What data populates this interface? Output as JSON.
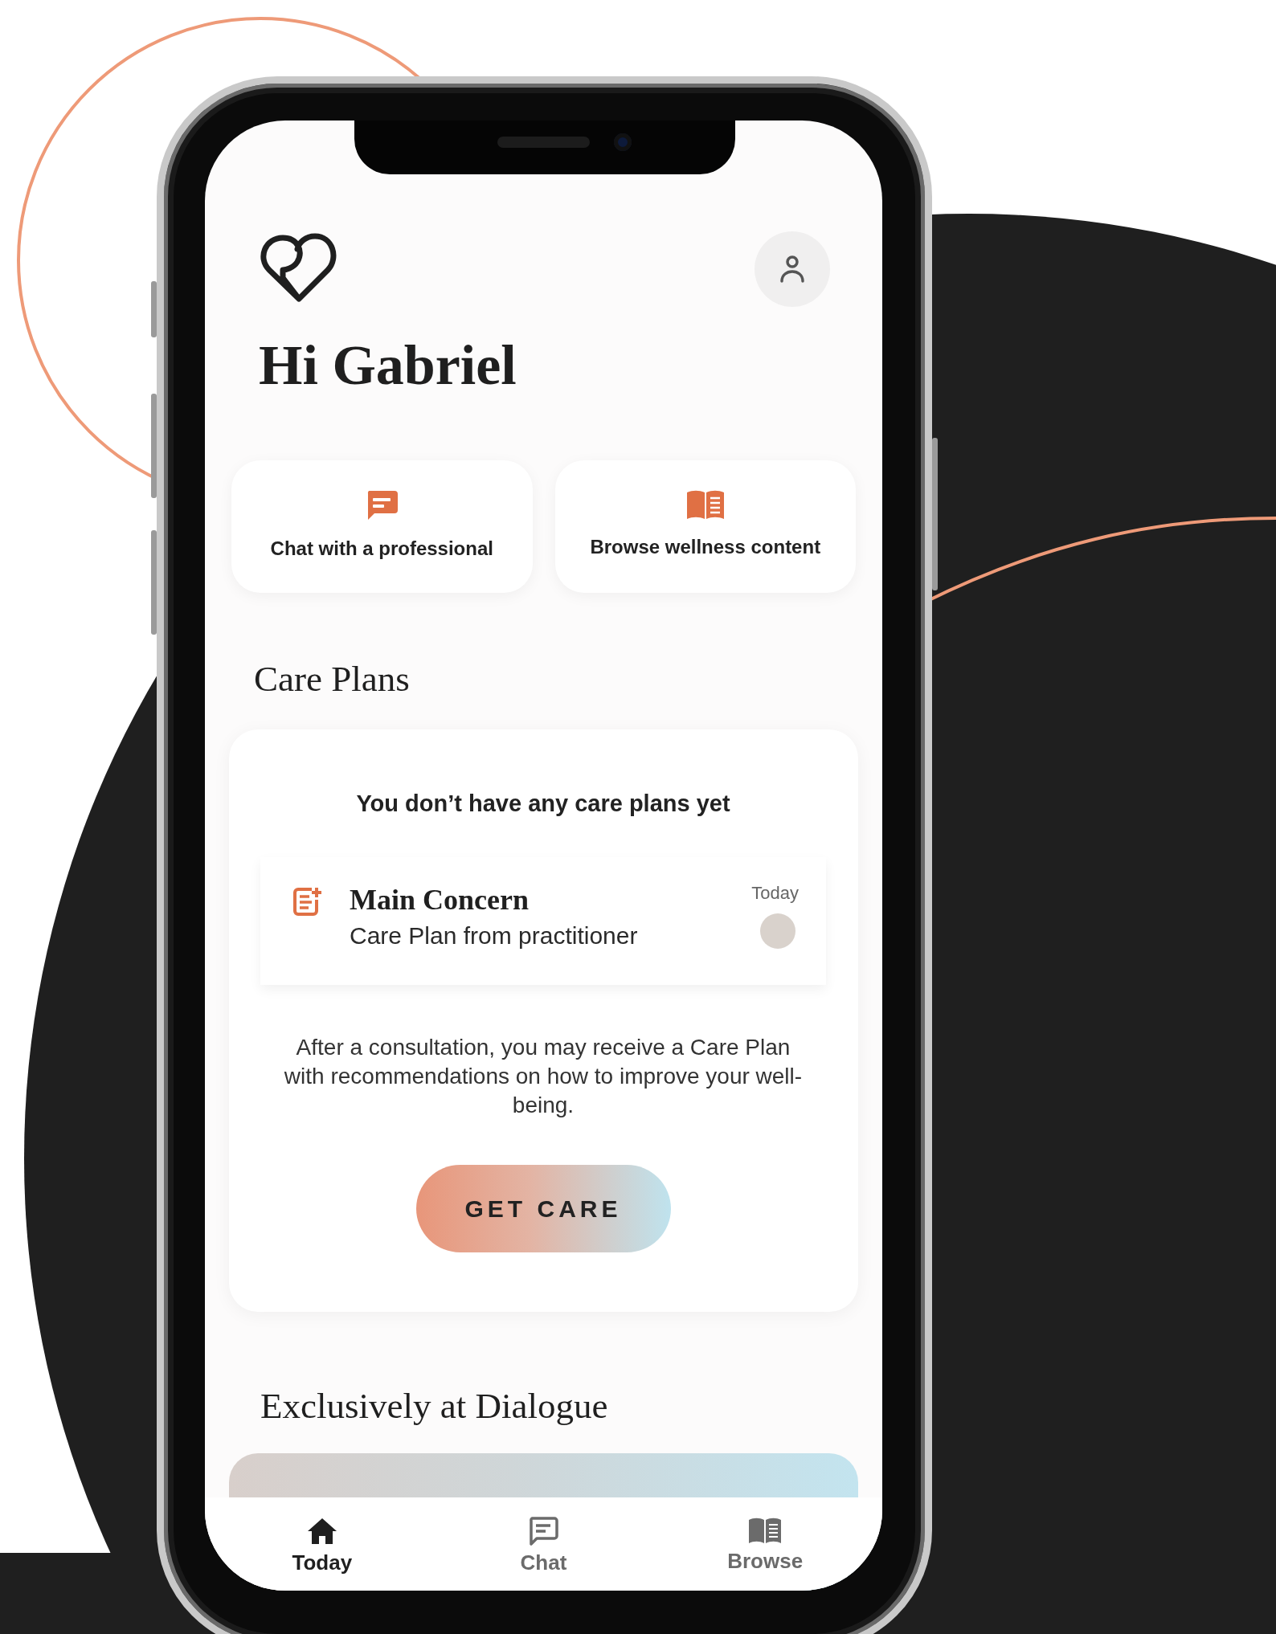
{
  "header": {
    "greeting": "Hi Gabriel"
  },
  "quick_actions": [
    {
      "kind": "chat",
      "label": "Chat with a professional"
    },
    {
      "kind": "book",
      "label": "Browse wellness content"
    }
  ],
  "care_plans": {
    "title": "Care Plans",
    "empty_message": "You don’t have any care plans yet",
    "example": {
      "title": "Main Concern",
      "subtitle": "Care Plan from practitioner",
      "date": "Today"
    },
    "description": "After a consultation, you may receive a Care Plan with recommendations on how to improve your well-being.",
    "button": "GET CARE"
  },
  "exclusive": {
    "title": "Exclusively at Dialogue"
  },
  "tab_bar": [
    {
      "kind": "home",
      "label": "Today",
      "selected": true
    },
    {
      "kind": "chat",
      "label": "Chat",
      "selected": false
    },
    {
      "kind": "book",
      "label": "Browse",
      "selected": false
    }
  ]
}
